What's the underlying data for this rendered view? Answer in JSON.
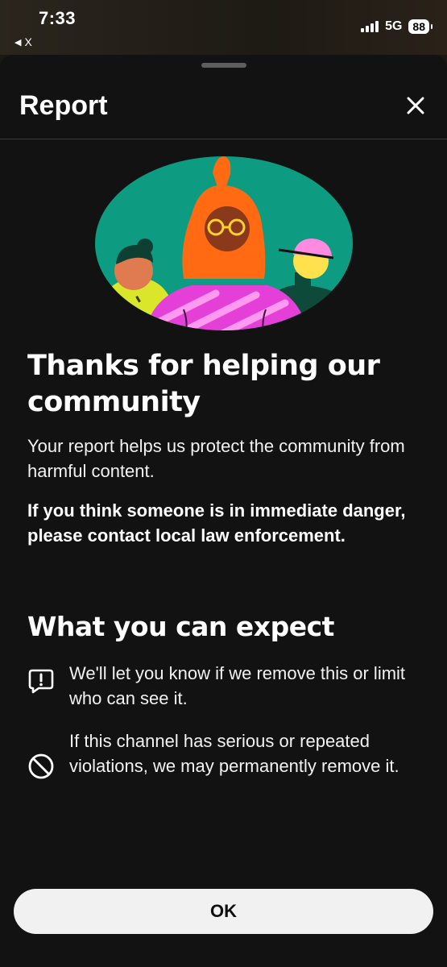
{
  "status_bar": {
    "time": "7:33",
    "back_app_label": "X",
    "network": "5G",
    "battery": "88"
  },
  "sheet": {
    "title": "Report",
    "close_icon": "close-icon"
  },
  "content": {
    "heading": "Thanks for helping our community",
    "subtext": "Your report helps us protect the community from harmful content.",
    "danger_notice": "If you think someone is in immediate danger, please contact local law enforcement."
  },
  "expect": {
    "heading": "What you can expect",
    "items": [
      {
        "icon": "alert-message-icon",
        "text": "We'll let you know if we remove this or limit who can see it."
      },
      {
        "icon": "prohibited-icon",
        "text": "If this channel has serious or repeated violations, we may permanently remove it."
      }
    ]
  },
  "actions": {
    "ok_label": "OK"
  },
  "colors": {
    "sheet_background": "#121212",
    "illustration_background": "#0d9c82",
    "button_background": "#f1f1f1"
  }
}
